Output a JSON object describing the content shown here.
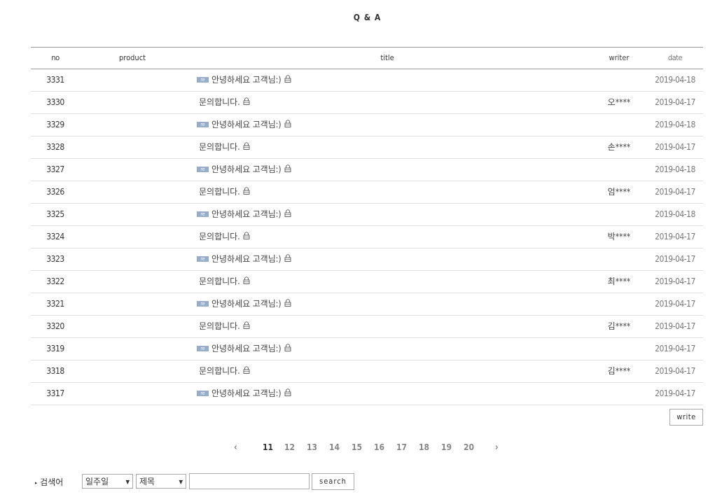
{
  "page": {
    "title": "Q & A"
  },
  "board": {
    "headers": {
      "no": "no",
      "product": "product",
      "title": "title",
      "writer": "writer",
      "date": "date"
    },
    "reply_badge": "re",
    "rows": [
      {
        "no": "3331",
        "reply": true,
        "title": "안녕하세요 고객님:)",
        "writer": "",
        "date": "2019-04-18"
      },
      {
        "no": "3330",
        "reply": false,
        "title": "문의합니다.",
        "writer": "오****",
        "date": "2019-04-17"
      },
      {
        "no": "3329",
        "reply": true,
        "title": "안녕하세요 고객님:)",
        "writer": "",
        "date": "2019-04-18"
      },
      {
        "no": "3328",
        "reply": false,
        "title": "문의합니다.",
        "writer": "손****",
        "date": "2019-04-17"
      },
      {
        "no": "3327",
        "reply": true,
        "title": "안녕하세요 고객님:)",
        "writer": "",
        "date": "2019-04-18"
      },
      {
        "no": "3326",
        "reply": false,
        "title": "문의합니다.",
        "writer": "엄****",
        "date": "2019-04-17"
      },
      {
        "no": "3325",
        "reply": true,
        "title": "안녕하세요 고객님:)",
        "writer": "",
        "date": "2019-04-18"
      },
      {
        "no": "3324",
        "reply": false,
        "title": "문의합니다.",
        "writer": "박****",
        "date": "2019-04-17"
      },
      {
        "no": "3323",
        "reply": true,
        "title": "안녕하세요 고객님:)",
        "writer": "",
        "date": "2019-04-17"
      },
      {
        "no": "3322",
        "reply": false,
        "title": "문의합니다.",
        "writer": "최****",
        "date": "2019-04-17"
      },
      {
        "no": "3321",
        "reply": true,
        "title": "안녕하세요 고객님:)",
        "writer": "",
        "date": "2019-04-17"
      },
      {
        "no": "3320",
        "reply": false,
        "title": "문의합니다.",
        "writer": "김****",
        "date": "2019-04-17"
      },
      {
        "no": "3319",
        "reply": true,
        "title": "안녕하세요 고객님:)",
        "writer": "",
        "date": "2019-04-17"
      },
      {
        "no": "3318",
        "reply": false,
        "title": "문의합니다.",
        "writer": "김****",
        "date": "2019-04-17"
      },
      {
        "no": "3317",
        "reply": true,
        "title": "안녕하세요 고객님:)",
        "writer": "",
        "date": "2019-04-17"
      }
    ],
    "write_label": "write"
  },
  "pagination": {
    "prev": "‹",
    "next": "›",
    "pages": [
      "11",
      "12",
      "13",
      "14",
      "15",
      "16",
      "17",
      "18",
      "19",
      "20"
    ],
    "current": "11"
  },
  "search": {
    "label": "검색어",
    "period": "일주일",
    "field": "제목",
    "keyword": "",
    "button": "search"
  },
  "colors": {
    "reply_badge": "#97acc9",
    "border": "#9a9a9a",
    "row_divider": "#e2e2e2"
  },
  "icons": {
    "lock": "lock-icon",
    "reply": "reply-badge"
  }
}
